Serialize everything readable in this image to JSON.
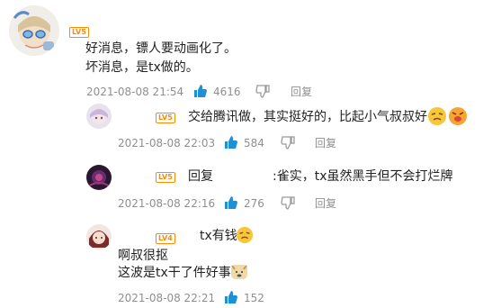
{
  "comments": [
    {
      "level": "LV5",
      "lines": [
        "好消息，镖人要动画化了。",
        "坏消息，是tx做的。"
      ],
      "time": "2021-08-08 21:54",
      "likes": "4616",
      "reply": "回复"
    },
    {
      "level": "LV5",
      "text": "交给腾讯做，其实挺好的，比起小气叔叔好",
      "time": "2021-08-08 22:03",
      "likes": "584",
      "reply": "回复"
    },
    {
      "level": "LV5",
      "prefix": "回复",
      "text": ":雀实，tx虽然黑手但不会打烂牌",
      "time": "2021-08-08 22:16",
      "likes": "276",
      "reply": "回复"
    },
    {
      "level": "LV4",
      "text1": "tx有钱",
      "lines": [
        "啊叔很抠",
        "这波是tx干了件好事"
      ],
      "time": "2021-08-08 22:21",
      "likes": "152"
    }
  ]
}
